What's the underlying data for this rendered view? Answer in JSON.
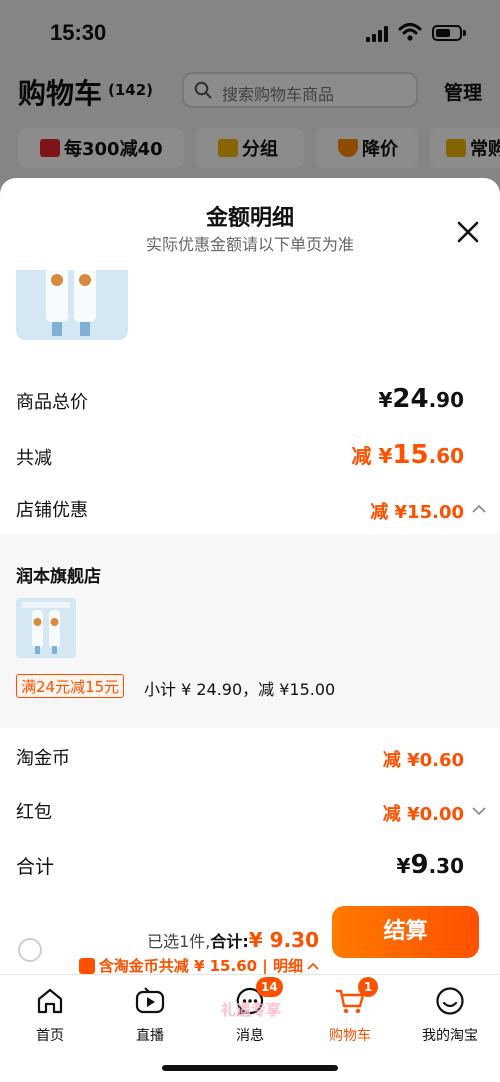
{
  "status": {
    "time": "15:30"
  },
  "header": {
    "title": "购物车",
    "count": "(142)",
    "search_placeholder": "搜索购物车商品",
    "manage": "管理"
  },
  "chips": [
    {
      "label": "每300减40",
      "icon": "red-bag-icon"
    },
    {
      "label": "分组",
      "icon": "folder-icon"
    },
    {
      "label": "降价",
      "icon": "arrow-down-icon"
    },
    {
      "label": "常购",
      "icon": "cart-icon"
    }
  ],
  "sheet": {
    "title": "金额明细",
    "subtitle": "实际优惠金额请以下单页为准",
    "rows": {
      "total_label": "商品总价",
      "total_yen": "¥",
      "total_int": "24",
      "total_dec": ".90",
      "discount_label": "共减",
      "discount_prefix": "减 ¥",
      "discount_int": "15",
      "discount_dec": ".60",
      "shop_label": "店铺优惠",
      "shop_value": "减 ¥15.00"
    },
    "store": {
      "name": "润本旗舰店",
      "promo_tag": "满24元减15元",
      "subtotal": "小计 ¥ 24.90，减 ¥15.00"
    },
    "coins_label": "淘金币",
    "coins_value": "减 ¥0.60",
    "redpack_label": "红包",
    "redpack_value": "减 ¥0.00",
    "sum_label": "合计",
    "sum_yen": "¥",
    "sum_int": "9",
    "sum_dec": ".30"
  },
  "bottom": {
    "selected": "已选1件,",
    "total_label": "合计:",
    "total_amount": "¥ 9.30",
    "detail": "含淘金币共减 ¥ 15.60 | 明细",
    "checkout": "结算"
  },
  "tabs": [
    {
      "label": "首页",
      "icon": "home-icon"
    },
    {
      "label": "直播",
      "icon": "live-play-icon"
    },
    {
      "label": "消息",
      "icon": "message-icon",
      "badge": "14"
    },
    {
      "label": "购物车",
      "icon": "cart-icon",
      "badge": "1",
      "active": true
    },
    {
      "label": "我的淘宝",
      "icon": "profile-smile-icon"
    }
  ],
  "watermark": "礼遇专享",
  "colors": {
    "accent": "#ff5000",
    "promo_bg": "#fff4ee",
    "panel": "#f7f7f7"
  }
}
